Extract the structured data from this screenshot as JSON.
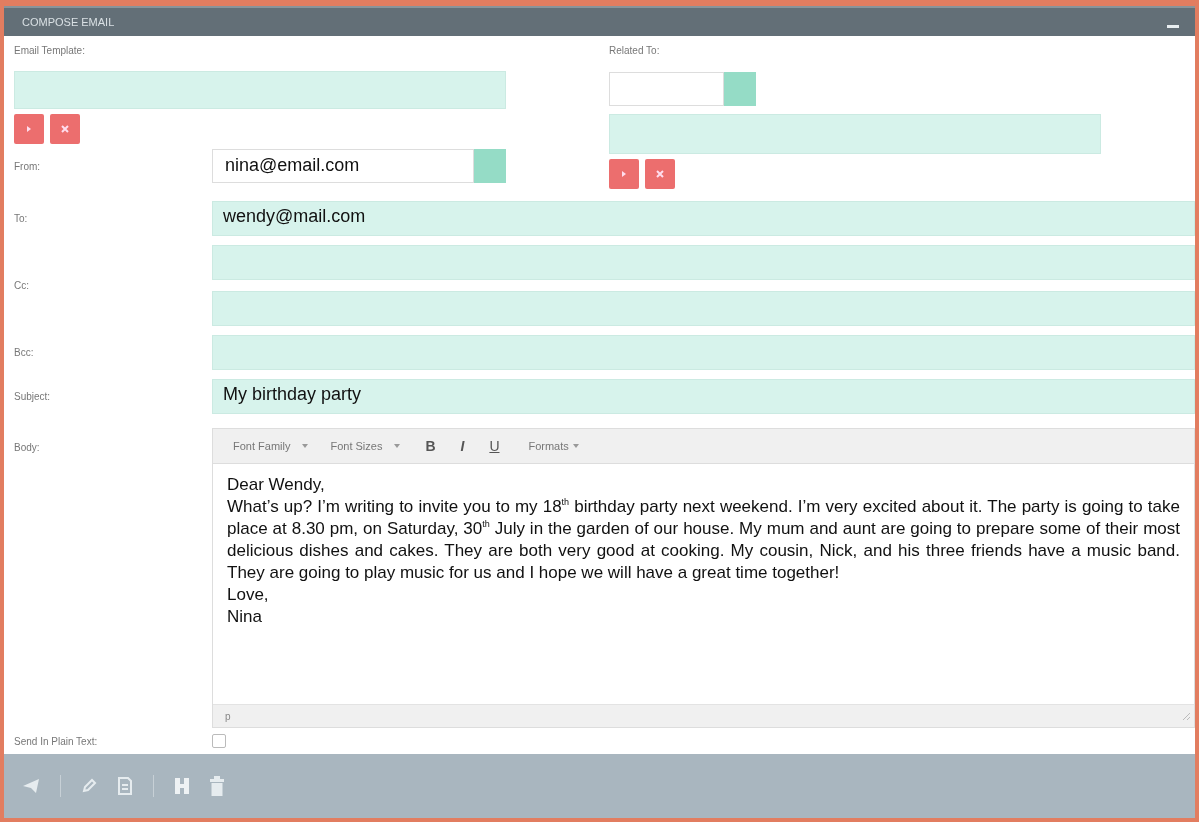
{
  "window": {
    "title": "COMPOSE EMAIL"
  },
  "email_template": {
    "label": "Email Template:"
  },
  "related_to": {
    "label": "Related To:"
  },
  "from": {
    "label": "From:",
    "value": "nina@email.com"
  },
  "fields": [
    {
      "label": "To:",
      "kind": "single",
      "value": "wendy@mail.com"
    },
    {
      "label": "Cc:",
      "kind": "double"
    },
    {
      "label": "Bcc:",
      "kind": "single"
    },
    {
      "label": "Subject:",
      "kind": "single",
      "value": "My birthday party"
    }
  ],
  "body": {
    "label": "Body:",
    "toolbar": [
      {
        "label": "Font Family",
        "kind": "dropdown"
      },
      {
        "label": "Font Sizes",
        "kind": "dropdown"
      },
      {
        "label": "B",
        "kind": "bold"
      },
      {
        "label": "I",
        "kind": "italic"
      },
      {
        "label": "U",
        "kind": "underline"
      },
      {
        "label": "Formats",
        "kind": "menu"
      }
    ],
    "lines": [
      "Dear Wendy,",
      "What’s up? I’m writing to invite you to my 18$^{th}$ birthday party next weekend. I’m very excited about it. The party is going to take place at 8.30 pm, on Saturday, 30$^{th}$ July in the garden of our house. My mum and aunt are going to prepare some of their most delicious dishes and cakes. They are both very good at cooking. My cousin, Nick, and his three friends have a music band. They are going to play music for us and I hope we will have a great time together!",
      "Love,",
      "Nina"
    ],
    "path": "p"
  },
  "plain_text": {
    "label": "Send In Plain Text:",
    "checked": false
  }
}
